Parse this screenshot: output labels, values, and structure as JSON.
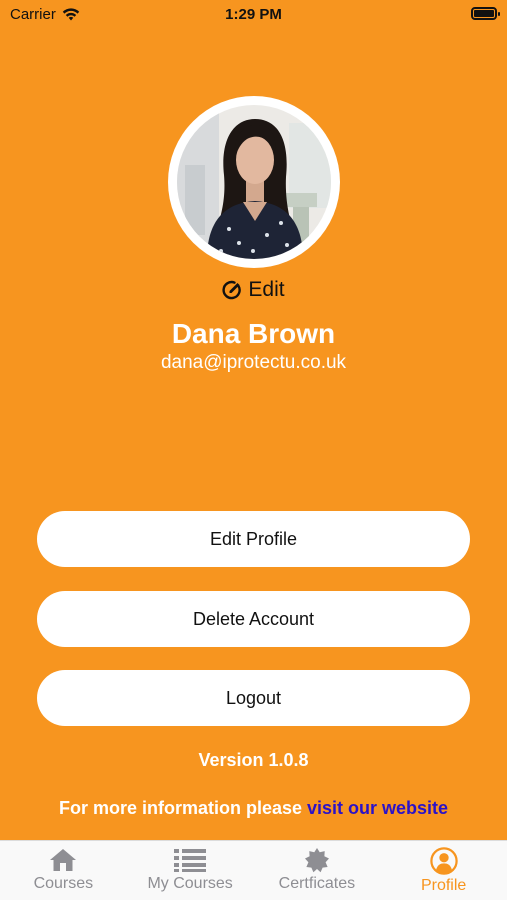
{
  "status_bar": {
    "carrier": "Carrier",
    "time": "1:29 PM"
  },
  "profile": {
    "edit_label": "Edit",
    "name": "Dana Brown",
    "email": "dana@iprotectu.co.uk"
  },
  "actions": {
    "edit_profile": "Edit Profile",
    "delete_account": "Delete Account",
    "logout": "Logout"
  },
  "footer": {
    "version": "Version 1.0.8",
    "info_text": "For more information please ",
    "info_link": "visit our website"
  },
  "tabs": [
    {
      "label": "Courses",
      "icon": "home-icon",
      "active": false
    },
    {
      "label": "My Courses",
      "icon": "list-icon",
      "active": false
    },
    {
      "label": "Certficates",
      "icon": "badge-icon",
      "active": false
    },
    {
      "label": "Profile",
      "icon": "profile-icon",
      "active": true
    }
  ],
  "colors": {
    "background": "#F7951F",
    "link": "#2B12C8",
    "tab_active": "#F7951F",
    "tab_inactive": "#8E8E93"
  }
}
